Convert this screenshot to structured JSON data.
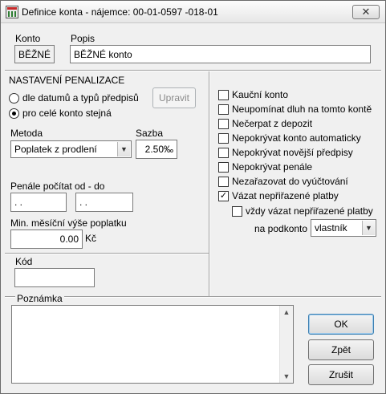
{
  "window": {
    "title": "Definice konta - nájemce: 00-01-0597 -018-01",
    "close_glyph": "✕"
  },
  "konto": {
    "label": "Konto",
    "value": "BĚŽNÉ"
  },
  "popis": {
    "label": "Popis",
    "value": "BĚŽNÉ konto"
  },
  "penalizace": {
    "heading": "NASTAVENÍ PENALIZACE",
    "radio1": "dle datumů a typů předpisů",
    "radio2": "pro celé konto stejná",
    "upravit": "Upravit",
    "metoda_label": "Metoda",
    "metoda_value": "Poplatek z prodlení",
    "sazba_label": "Sazba",
    "sazba_value": "2.50‰",
    "penale_label": "Penále počítat od - do",
    "date_from": " .  . ",
    "date_to": " .  . ",
    "min_label": "Min. měsíční výše poplatku",
    "min_value": "0.00",
    "min_unit": "Kč"
  },
  "kod": {
    "label": "Kód",
    "value": ""
  },
  "poznamka": {
    "label": "Poznámka",
    "value": ""
  },
  "options": [
    {
      "label": "Kauční konto",
      "checked": false
    },
    {
      "label": "Neupomínat dluh na tomto kontě",
      "checked": false
    },
    {
      "label": "Nečerpat z depozit",
      "checked": false
    },
    {
      "label": "Nepokrývat konto automaticky",
      "checked": false
    },
    {
      "label": "Nepokrývat novější předpisy",
      "checked": false
    },
    {
      "label": "Nepokrývat penále",
      "checked": false
    },
    {
      "label": "Nezařazovat do vyúčtování",
      "checked": false
    },
    {
      "label": "Vázat nepřiřazené platby",
      "checked": true
    }
  ],
  "vzdy": {
    "label": "vždy vázat nepřiřazené platby",
    "checked": false
  },
  "podkonto": {
    "label": "na podkonto",
    "value": "vlastník"
  },
  "buttons": {
    "ok": "OK",
    "zpet": "Zpět",
    "zrusit": "Zrušit"
  }
}
